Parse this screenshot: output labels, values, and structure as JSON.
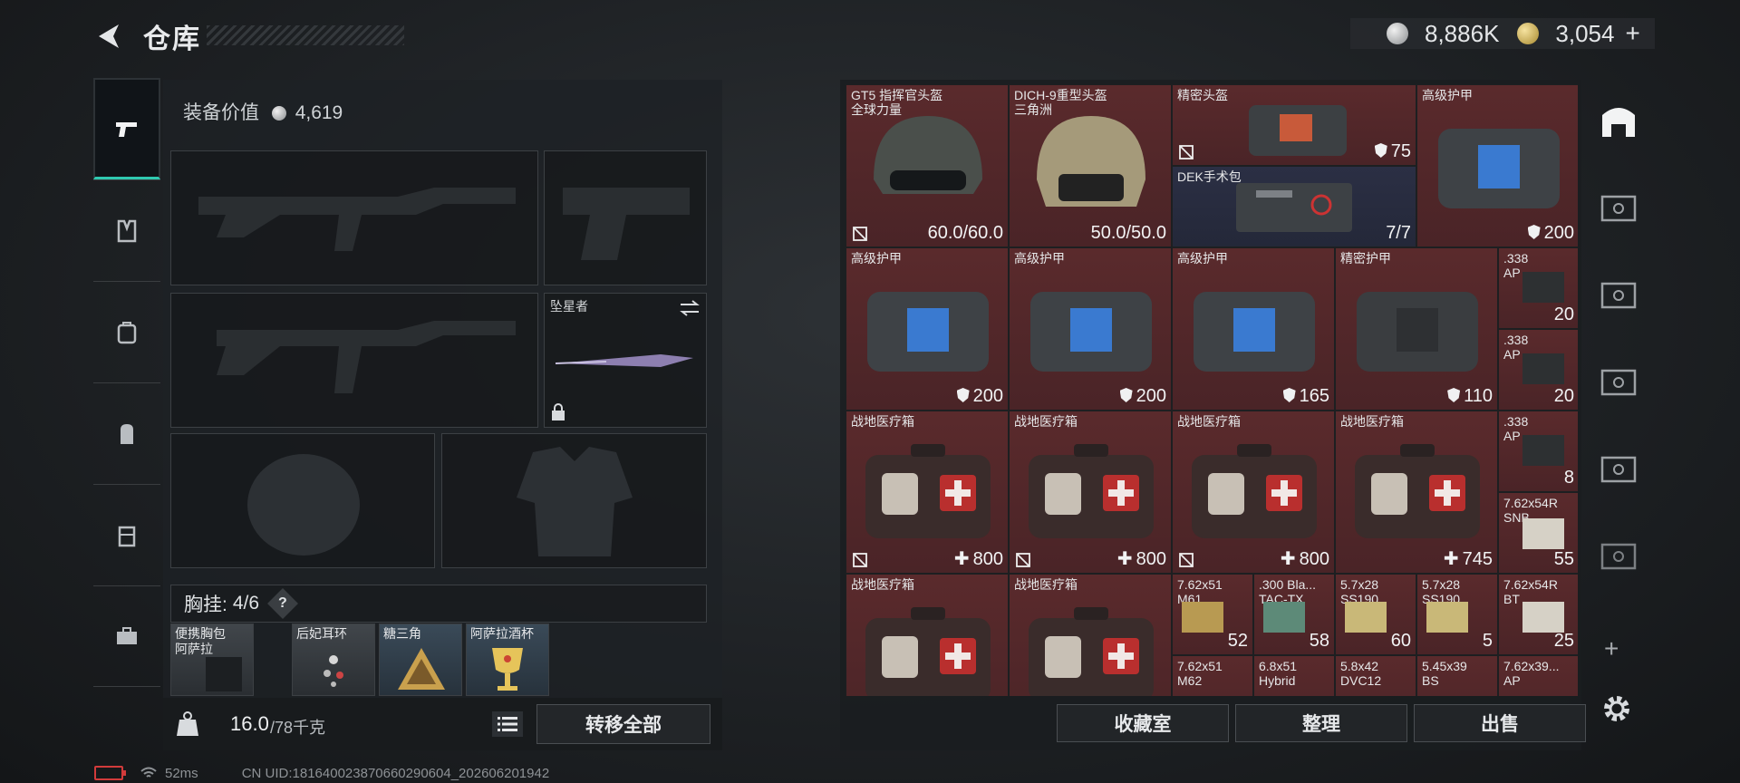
{
  "header": {
    "title": "仓库"
  },
  "currency": {
    "silver": "8,886K",
    "gold": "3,054",
    "add_label": "+"
  },
  "version_text": "",
  "loadout": {
    "equip_value_label": "装备价值",
    "equip_value": "4,619",
    "melee_name": "坠星者",
    "chest_label": "胸挂:",
    "chest_count": "4/6",
    "help_label": "?",
    "pockets": [
      {
        "name": "便携胸包\n阿萨拉"
      },
      {
        "name": "后妃耳环"
      },
      {
        "name": "糖三角"
      },
      {
        "name": "阿萨拉酒杯"
      }
    ],
    "weight_current": "16.0",
    "weight_max": "/78千克",
    "transfer_all": "转移全部"
  },
  "stash": {
    "items": [
      {
        "name": "GT5 指挥官头盔\n全球力量",
        "value": "60.0/60.0",
        "bg": "red"
      },
      {
        "name": "DICH-9重型头盔\n三角洲",
        "value": "50.0/50.0",
        "bg": "red"
      },
      {
        "name": "精密头盔",
        "value": "75",
        "bg": "red"
      },
      {
        "name": "DEK手术包",
        "value": "7/7",
        "bg": "blue"
      },
      {
        "name": "高级护甲",
        "value": "200",
        "bg": "red"
      },
      {
        "name": "高级护甲",
        "value": "200",
        "bg": "red"
      },
      {
        "name": "高级护甲",
        "value": "200",
        "bg": "red"
      },
      {
        "name": "高级护甲",
        "value": "165",
        "bg": "red"
      },
      {
        "name": "精密护甲",
        "value": "110",
        "bg": "red"
      },
      {
        "name": ".338\nAP",
        "value": "20",
        "bg": "red"
      },
      {
        "name": ".338\nAP",
        "value": "20",
        "bg": "red"
      },
      {
        "name": "战地医疗箱",
        "value": "800",
        "bg": "red"
      },
      {
        "name": "战地医疗箱",
        "value": "800",
        "bg": "red"
      },
      {
        "name": "战地医疗箱",
        "value": "800",
        "bg": "red"
      },
      {
        "name": "战地医疗箱",
        "value": "745",
        "bg": "red"
      },
      {
        "name": ".338\nAP",
        "value": "8",
        "bg": "red"
      },
      {
        "name": "7.62x54R\nSNB",
        "value": "55",
        "bg": "red"
      },
      {
        "name": "战地医疗箱",
        "value": "",
        "bg": "red"
      },
      {
        "name": "战地医疗箱",
        "value": "",
        "bg": "red"
      },
      {
        "name": "7.62x51\nM61",
        "value": "52",
        "bg": "red"
      },
      {
        "name": ".300 Bla...\nTAC-TX",
        "value": "58",
        "bg": "red"
      },
      {
        "name": "5.7x28\nSS190",
        "value": "60",
        "bg": "red"
      },
      {
        "name": "5.7x28\nSS190",
        "value": "5",
        "bg": "red"
      },
      {
        "name": "7.62x54R\nBT",
        "value": "25",
        "bg": "red"
      },
      {
        "name": "7.62x51\nM62",
        "value": "",
        "bg": "red"
      },
      {
        "name": "6.8x51\nHybrid",
        "value": "",
        "bg": "red"
      },
      {
        "name": "5.8x42\nDVC12",
        "value": "",
        "bg": "red"
      },
      {
        "name": "5.45x39\nBS",
        "value": "",
        "bg": "red"
      },
      {
        "name": "7.62x39...\nAP",
        "value": "",
        "bg": "red"
      }
    ],
    "buttons": {
      "collection": "收藏室",
      "sort": "整理",
      "sell": "出售"
    }
  },
  "status": {
    "ping": "52ms",
    "uid": "CN UID:18164002387066029​0604_202606201942"
  }
}
